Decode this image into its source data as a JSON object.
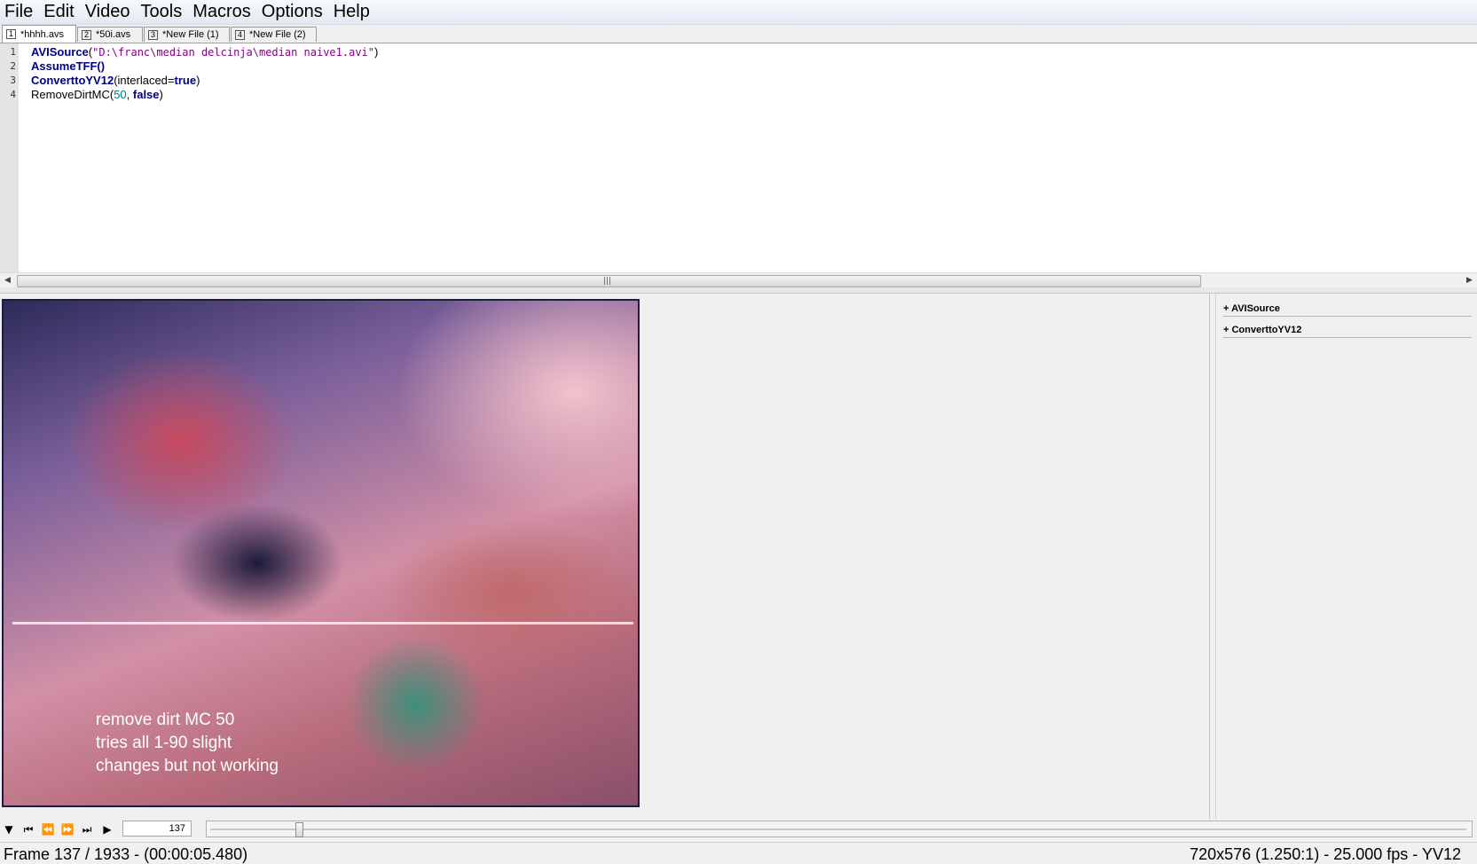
{
  "menu": [
    "File",
    "Edit",
    "Video",
    "Tools",
    "Macros",
    "Options",
    "Help"
  ],
  "tabs": [
    {
      "num": "1",
      "label": "*hhhh.avs",
      "active": true
    },
    {
      "num": "2",
      "label": "*50i.avs",
      "active": false
    },
    {
      "num": "3",
      "label": "*New File (1)",
      "active": false
    },
    {
      "num": "4",
      "label": "*New File (2)",
      "active": false
    }
  ],
  "editor": {
    "lines": [
      {
        "num": "1",
        "fn": "AVISource",
        "open": "(",
        "str": "\"D:\\franc\\median delcinja\\median naive1.avi\"",
        "close": ")"
      },
      {
        "num": "2",
        "fn": "AssumeTFF",
        "args": "()"
      },
      {
        "num": "3",
        "fn": "ConverttoYV12",
        "open": "(interlaced=",
        "bool": "true",
        "close": ")"
      },
      {
        "num": "4",
        "fn": "RemoveDirtMC",
        "open": "(",
        "num_lit": "50",
        "sep": ", ",
        "bool": "false",
        "close": ")"
      }
    ]
  },
  "video": {
    "caption_lines": [
      "remove dirt MC 50",
      "tries all 1-90 slight",
      "changes but not working"
    ]
  },
  "filters": [
    "+ AVISource",
    "+ ConverttoYV12"
  ],
  "playback": {
    "frame_value": "137",
    "position": 0.0709,
    "icons": [
      "menu-triangle-icon",
      "skip-start-icon",
      "step-back-icon",
      "step-forward-icon",
      "skip-end-icon",
      "play-icon"
    ]
  },
  "status": {
    "left": "Frame 137 / 1933  -  (00:00:05.480)",
    "right": "720x576 (1.250:1)  -  25.000 fps  -  YV12"
  }
}
